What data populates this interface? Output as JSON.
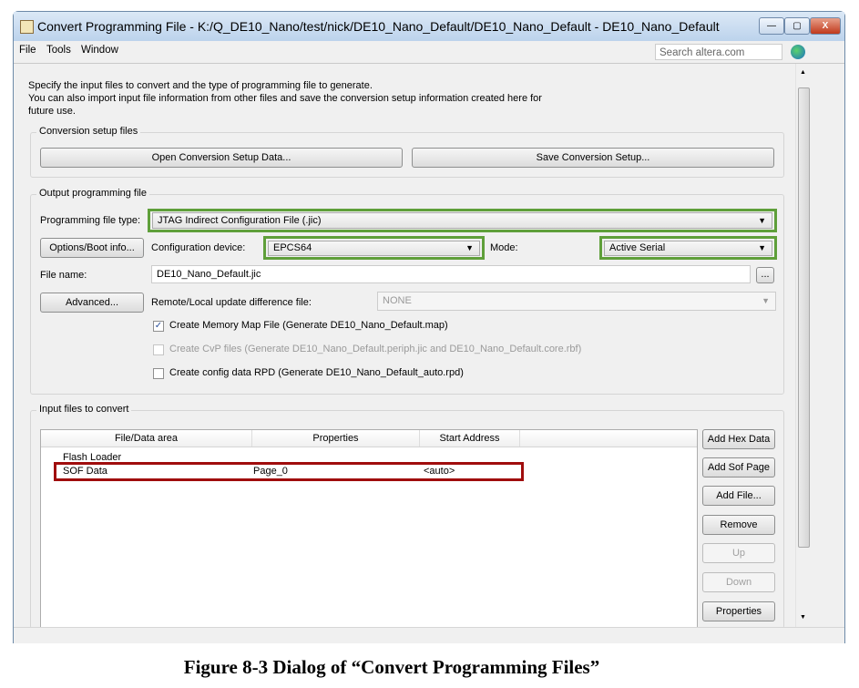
{
  "window": {
    "title": "Convert Programming File - K:/Q_DE10_Nano/test/nick/DE10_Nano_Default/DE10_Nano_Default - DE10_Nano_Default",
    "minimize": "—",
    "maximize": "▢",
    "close": "X"
  },
  "menu": [
    "File",
    "Tools",
    "Window"
  ],
  "search": {
    "placeholder": "Search altera.com"
  },
  "intro": [
    "Specify the input files to convert and the type of programming file to generate.",
    "You can also import input file information from other files and save the conversion setup information created here for",
    "future use."
  ],
  "setup": {
    "label": "Conversion setup files",
    "open": "Open Conversion Setup Data...",
    "save": "Save Conversion Setup..."
  },
  "output": {
    "label": "Output programming file",
    "type_label": "Programming file type:",
    "type_value": "JTAG Indirect Configuration File (.jic)",
    "options_btn": "Options/Boot info...",
    "device_label": "Configuration device:",
    "device_value": "EPCS64",
    "mode_label": "Mode:",
    "mode_value": "Active Serial",
    "filename_label": "File name:",
    "filename_value": "DE10_Nano_Default.jic",
    "browse": "...",
    "advanced_btn": "Advanced...",
    "remote_label": "Remote/Local update difference file:",
    "remote_value": "NONE",
    "checks": [
      {
        "label": "Create Memory Map File (Generate DE10_Nano_Default.map)",
        "checked": "✓"
      },
      {
        "label": "Create CvP files (Generate DE10_Nano_Default.periph.jic and DE10_Nano_Default.core.rbf)",
        "checked": ""
      },
      {
        "label": "Create config data RPD (Generate DE10_Nano_Default_auto.rpd)",
        "checked": ""
      }
    ]
  },
  "input": {
    "label": "Input files to convert",
    "columns": [
      "File/Data area",
      "Properties",
      "Start Address"
    ],
    "rows": [
      {
        "name": "Flash Loader",
        "props": "",
        "addr": ""
      },
      {
        "name": "SOF Data",
        "props": "Page_0",
        "addr": "<auto>"
      }
    ],
    "buttons": [
      "Add Hex Data",
      "Add Sof Page",
      "Add File...",
      "Remove",
      "Up",
      "Down",
      "Properties"
    ]
  },
  "caption": "Figure 8-3 Dialog of “Convert Programming Files”",
  "colors": {
    "highlight_green": "#5f9f3a",
    "highlight_red": "#a00d0d"
  }
}
